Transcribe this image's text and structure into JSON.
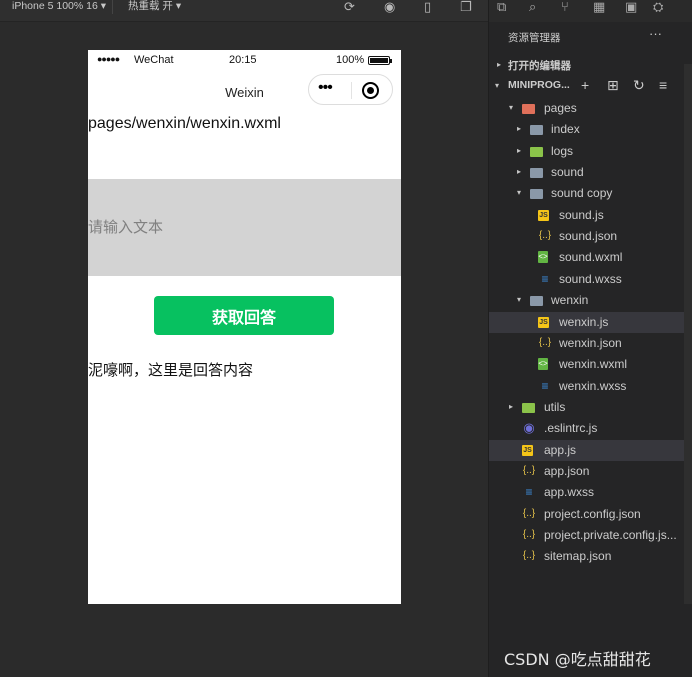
{
  "toolbar": {
    "device": "iPhone 5 100% 16 ▾",
    "hot_reload": "热重载 开 ▾"
  },
  "simulator": {
    "status": {
      "carrier": "WeChat",
      "time": "20:15",
      "battery": "100%"
    },
    "nav_title": "Weixin",
    "path_text": "pages/wenxin/wenxin.wxml",
    "input_placeholder": "请输入文本",
    "button_label": "获取回答",
    "answer_text": "泥嚎啊，这里是回答内容"
  },
  "explorer": {
    "header": "资源管理器",
    "more": "···",
    "open_editors": "打开的编辑器",
    "project": "MINIPROG...",
    "tree": [
      {
        "name": "pages",
        "type": "folder-red",
        "depth": 1,
        "caret": "▾"
      },
      {
        "name": "index",
        "type": "folder",
        "depth": 2,
        "caret": "▸"
      },
      {
        "name": "logs",
        "type": "folder-green",
        "depth": 2,
        "caret": "▸"
      },
      {
        "name": "sound",
        "type": "folder",
        "depth": 2,
        "caret": "▸"
      },
      {
        "name": "sound copy",
        "type": "folder",
        "depth": 2,
        "caret": "▾"
      },
      {
        "name": "sound.js",
        "type": "js",
        "depth": 3
      },
      {
        "name": "sound.json",
        "type": "json",
        "depth": 3
      },
      {
        "name": "sound.wxml",
        "type": "wxml",
        "depth": 3
      },
      {
        "name": "sound.wxss",
        "type": "wxss",
        "depth": 3
      },
      {
        "name": "wenxin",
        "type": "folder",
        "depth": 2,
        "caret": "▾"
      },
      {
        "name": "wenxin.js",
        "type": "js",
        "depth": 3,
        "selected": true
      },
      {
        "name": "wenxin.json",
        "type": "json",
        "depth": 3
      },
      {
        "name": "wenxin.wxml",
        "type": "wxml",
        "depth": 3
      },
      {
        "name": "wenxin.wxss",
        "type": "wxss",
        "depth": 3
      },
      {
        "name": "utils",
        "type": "folder-green",
        "depth": 1,
        "caret": "▸"
      },
      {
        "name": ".eslintrc.js",
        "type": "eslint",
        "depth": 1
      },
      {
        "name": "app.js",
        "type": "js",
        "depth": 1,
        "selected": true
      },
      {
        "name": "app.json",
        "type": "json",
        "depth": 1
      },
      {
        "name": "app.wxss",
        "type": "wxss",
        "depth": 1
      },
      {
        "name": "project.config.json",
        "type": "json",
        "depth": 1
      },
      {
        "name": "project.private.config.js...",
        "type": "json",
        "depth": 1
      },
      {
        "name": "sitemap.json",
        "type": "json",
        "depth": 1
      }
    ]
  },
  "watermark": "CSDN @吃点甜甜花"
}
